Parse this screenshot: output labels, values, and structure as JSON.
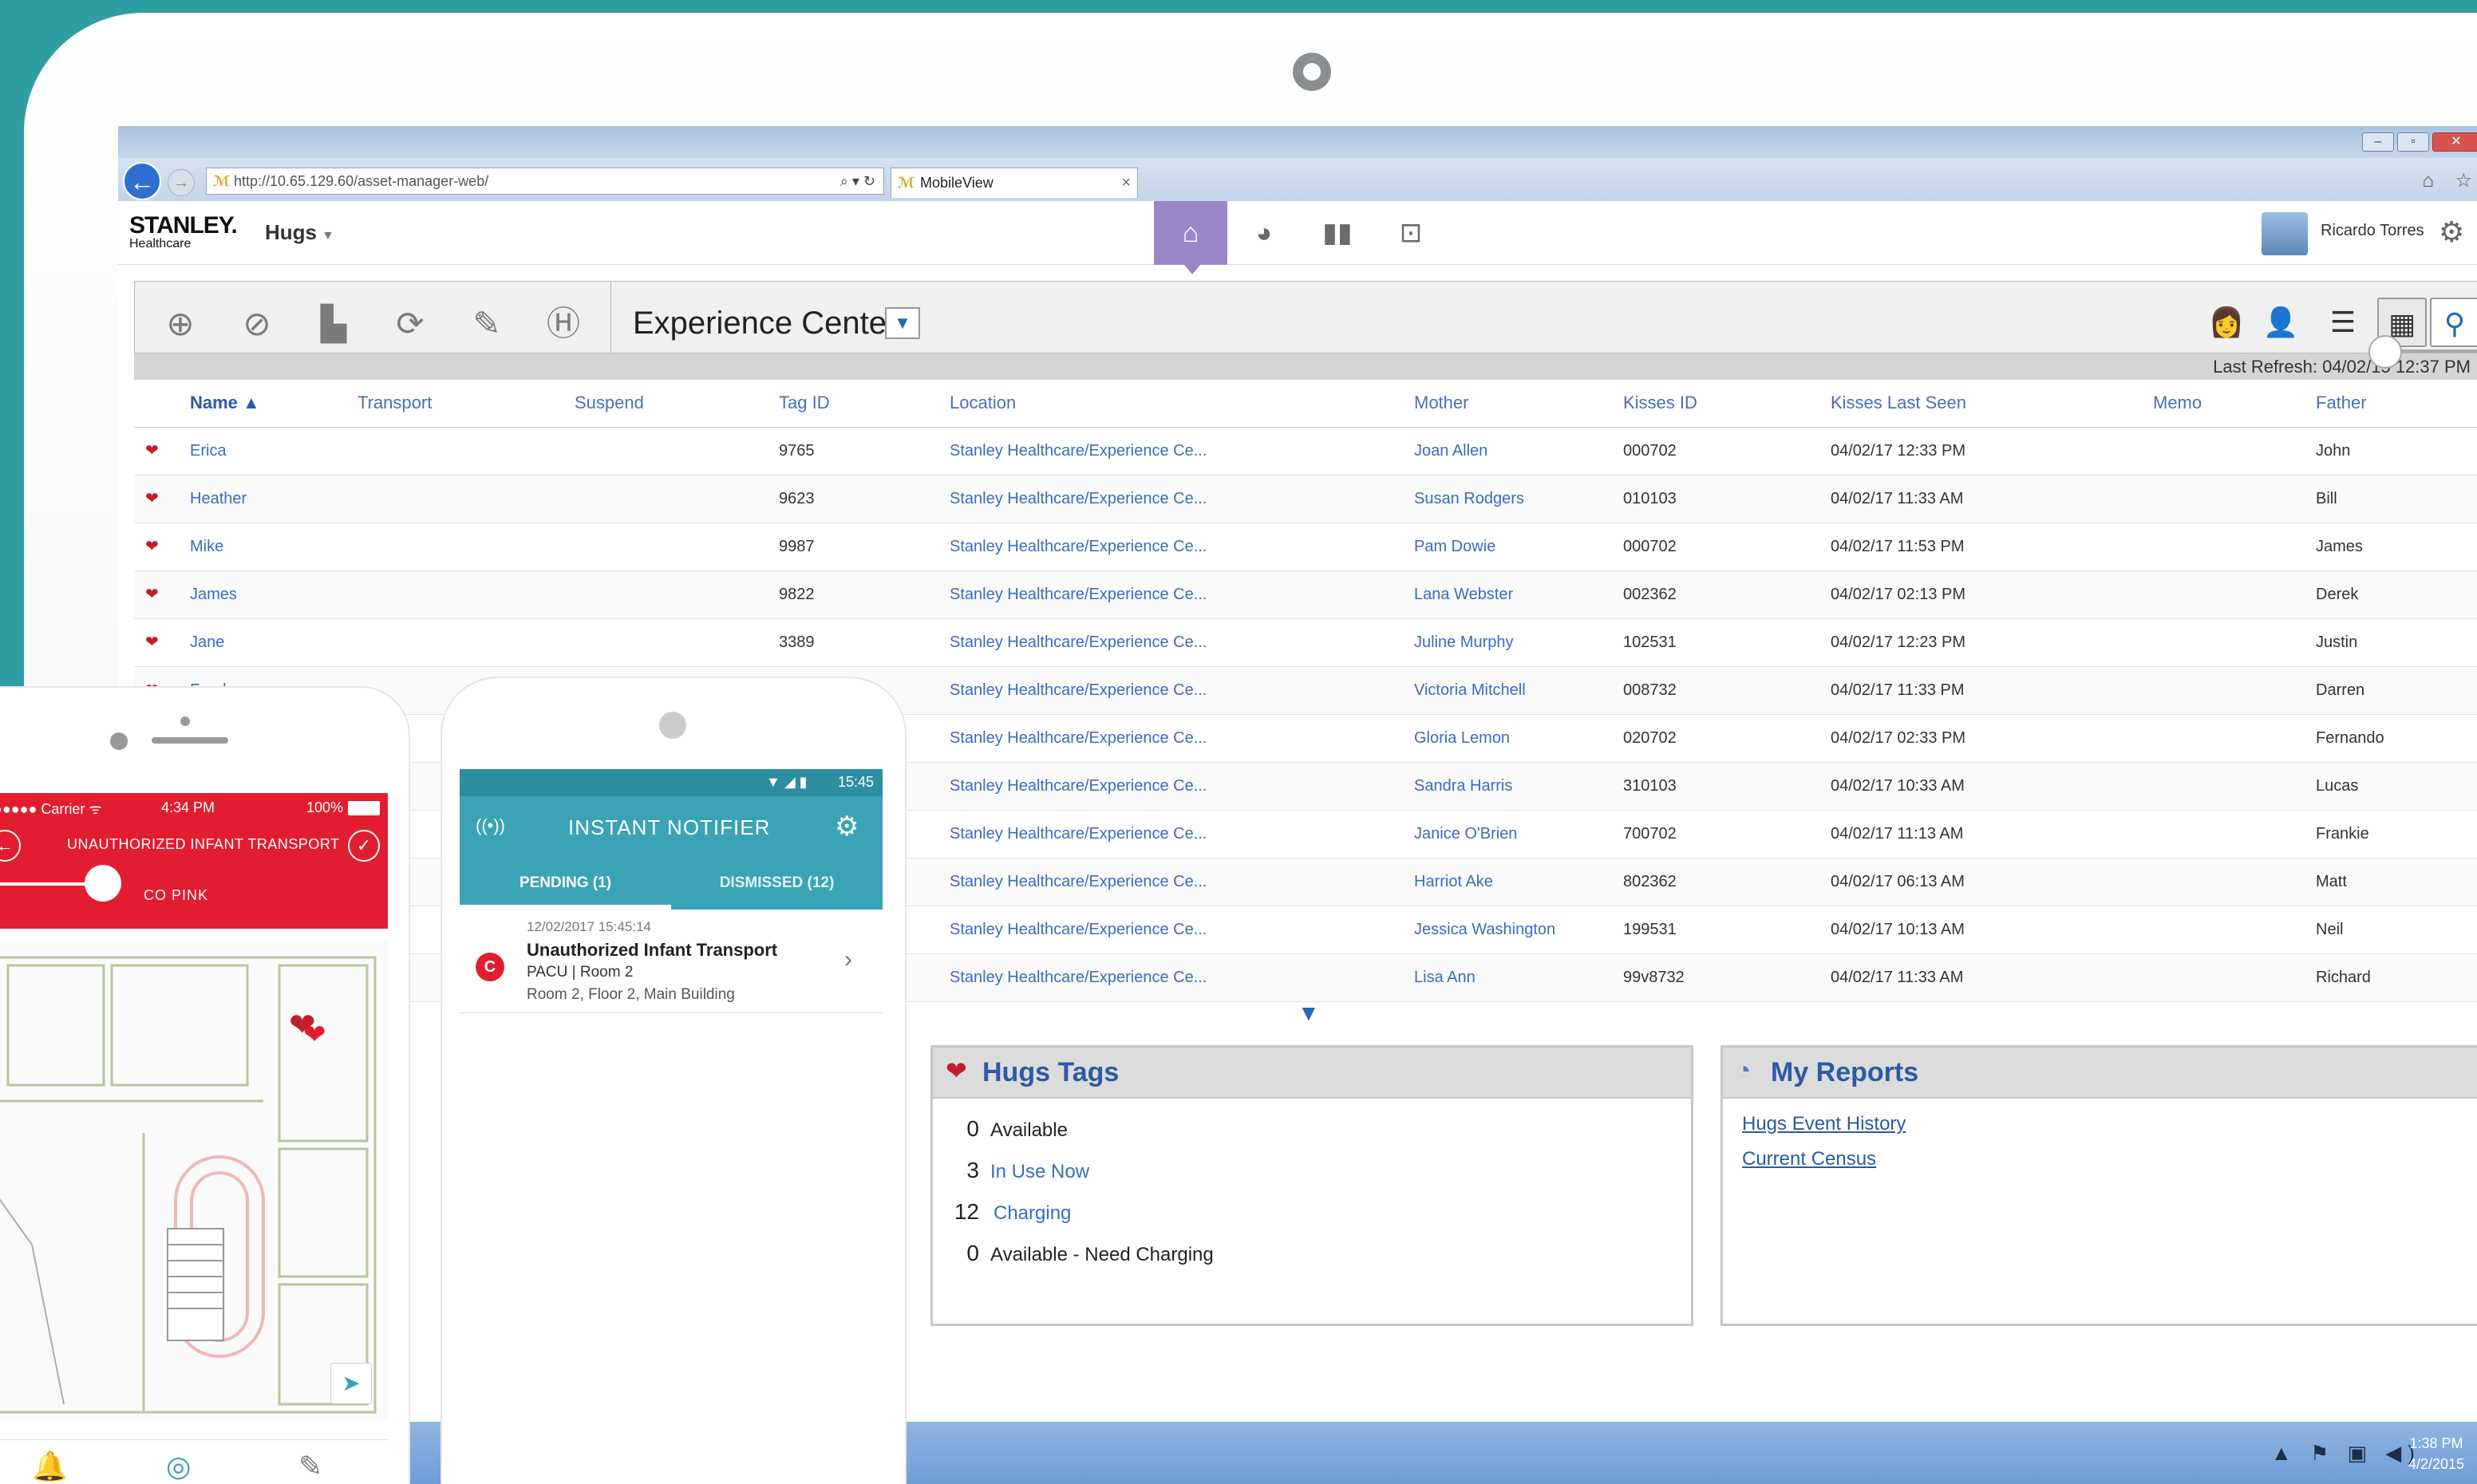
{
  "browser": {
    "url": "http://10.65.129.60/asset-manager-web/",
    "tab_title": "MobileView",
    "url_tools": "⌕ ▾ ↻",
    "tab_close": "×",
    "window_controls": [
      "–",
      "▫",
      "✕"
    ],
    "icons": "⌂ ☆"
  },
  "app": {
    "brand": "STANLEY.",
    "brand_sub": "Healthcare",
    "module": "Hugs",
    "user": "Ricardo Torres"
  },
  "toolbar": {
    "location": "Experience Center",
    "last_refresh": "Last Refresh: 04/02/15 12:37 PM"
  },
  "table": {
    "headers": {
      "name": "Name ▲",
      "transport": "Transport",
      "suspend": "Suspend",
      "tag_id": "Tag ID",
      "location": "Location",
      "mother": "Mother",
      "kisses_id": "Kisses ID",
      "kisses_last_seen": "Kisses Last Seen",
      "memo": "Memo",
      "father": "Father"
    },
    "rows": [
      {
        "name": "Erica",
        "tag": "9765",
        "location": "Stanley Healthcare/Experience Ce...",
        "mother": "Joan Allen",
        "kisses": "000702",
        "seen": "04/02/17  12:33 PM",
        "father": "John"
      },
      {
        "name": "Heather",
        "tag": "9623",
        "location": "Stanley Healthcare/Experience Ce...",
        "mother": "Susan Rodgers",
        "kisses": "010103",
        "seen": "04/02/17  11:33 AM",
        "father": "Bill"
      },
      {
        "name": "Mike",
        "tag": "9987",
        "location": "Stanley Healthcare/Experience Ce...",
        "mother": "Pam Dowie",
        "kisses": "000702",
        "seen": "04/02/17  11:53 PM",
        "father": "James"
      },
      {
        "name": "James",
        "tag": "9822",
        "location": "Stanley Healthcare/Experience Ce...",
        "mother": "Lana Webster",
        "kisses": "002362",
        "seen": "04/02/17  02:13 PM",
        "father": "Derek"
      },
      {
        "name": "Jane",
        "tag": "3389",
        "location": "Stanley Healthcare/Experience Ce...",
        "mother": "Juline Murphy",
        "kisses": "102531",
        "seen": "04/02/17  12:23 PM",
        "father": "Justin"
      },
      {
        "name": "Frank",
        "tag": "",
        "location": "Stanley Healthcare/Experience Ce...",
        "mother": "Victoria Mitchell",
        "kisses": "008732",
        "seen": "04/02/17  11:33 PM",
        "father": "Darren"
      },
      {
        "name": "",
        "tag": "",
        "location": "Stanley Healthcare/Experience Ce...",
        "mother": "Gloria Lemon",
        "kisses": "020702",
        "seen": "04/02/17  02:33 PM",
        "father": "Fernando"
      },
      {
        "name": "",
        "tag": "",
        "location": "Stanley Healthcare/Experience Ce...",
        "mother": "Sandra Harris",
        "kisses": "310103",
        "seen": "04/02/17  10:33 AM",
        "father": "Lucas"
      },
      {
        "name": "",
        "tag": "",
        "location": "Stanley Healthcare/Experience Ce...",
        "mother": "Janice O'Brien",
        "kisses": "700702",
        "seen": "04/02/17  11:13 AM",
        "father": "Frankie"
      },
      {
        "name": "",
        "tag": "",
        "location": "Stanley Healthcare/Experience Ce...",
        "mother": "Harriot Ake",
        "kisses": "802362",
        "seen": "04/02/17  06:13 AM",
        "father": "Matt"
      },
      {
        "name": "",
        "tag": "",
        "location": "Stanley Healthcare/Experience Ce...",
        "mother": "Jessica Washington",
        "kisses": "199531",
        "seen": "04/02/17  10:13 AM",
        "father": "Neil"
      },
      {
        "name": "",
        "tag": "",
        "location": "Stanley Healthcare/Experience Ce...",
        "mother": "Lisa Ann",
        "kisses": "99v8732",
        "seen": "04/02/17  11:33 AM",
        "father": "Richard"
      }
    ]
  },
  "hugs_tags": {
    "title": "Hugs Tags",
    "stats": [
      {
        "num": "0",
        "label": "Available"
      },
      {
        "num": "3",
        "label": "In Use Now"
      },
      {
        "num": "12",
        "label": "Charging"
      },
      {
        "num": "0",
        "label": "Available - Need Charging"
      }
    ]
  },
  "my_reports": {
    "title": "My Reports",
    "links": [
      "Hugs Event History",
      "Current Census"
    ]
  },
  "taskbar": {
    "time": "1:38 PM",
    "date": "4/2/2015",
    "tray": "▲ ⚑ ▣ ◀)"
  },
  "iphone": {
    "carrier": "●●●●● Carrier ᯤ",
    "time": "4:34 PM",
    "battery": "100%",
    "alert_title": "UNAUTHORIZED INFANT TRANSPORT",
    "slider_label": "CO    PINK"
  },
  "android": {
    "status_time": "15:45",
    "status_icons": "▼ ◢ ▮",
    "title": "INSTANT NOTIFIER",
    "tab_pending": "PENDING (1)",
    "tab_dismissed": "DISMISSED (12)",
    "notification": {
      "badge": "C",
      "timestamp": "12/02/2017  15:45:14",
      "title": "Unauthorized Infant Transport",
      "line1": "PACU | Room 2",
      "line2": "Room 2, Floor 2, Main Building"
    }
  },
  "colors": {
    "background": "#2f9ea3",
    "nav_active": "#9b87c8",
    "alert_red": "#e11d2f",
    "notifier_teal": "#3aa3b5",
    "link_blue": "#3a6cc0"
  }
}
